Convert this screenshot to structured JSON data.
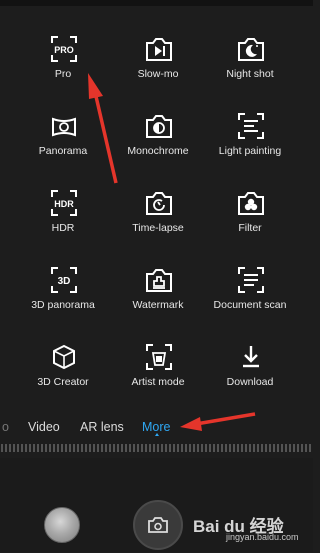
{
  "modes": [
    {
      "label": "Pro",
      "icon": "pro-icon"
    },
    {
      "label": "Slow-mo",
      "icon": "slow-motion-icon"
    },
    {
      "label": "Night shot",
      "icon": "night-shot-icon"
    },
    {
      "label": "Panorama",
      "icon": "panorama-icon"
    },
    {
      "label": "Monochrome",
      "icon": "monochrome-icon"
    },
    {
      "label": "Light painting",
      "icon": "light-painting-icon"
    },
    {
      "label": "HDR",
      "icon": "hdr-icon"
    },
    {
      "label": "Time-lapse",
      "icon": "time-lapse-icon"
    },
    {
      "label": "Filter",
      "icon": "filter-icon"
    },
    {
      "label": "3D panorama",
      "icon": "3d-panorama-icon"
    },
    {
      "label": "Watermark",
      "icon": "watermark-icon"
    },
    {
      "label": "Document scan",
      "icon": "document-scan-icon"
    },
    {
      "label": "3D Creator",
      "icon": "3d-creator-icon"
    },
    {
      "label": "Artist mode",
      "icon": "artist-mode-icon"
    },
    {
      "label": "Download",
      "icon": "download-icon"
    }
  ],
  "tabs": {
    "partial": "o",
    "video": "Video",
    "ar_lens": "AR lens",
    "more": "More"
  },
  "watermark": {
    "brand": "Bai du 经验",
    "url": "jingyan.baidu.com"
  },
  "colors": {
    "accent": "#2fa7f2",
    "annotation_arrow": "#e5352b"
  }
}
